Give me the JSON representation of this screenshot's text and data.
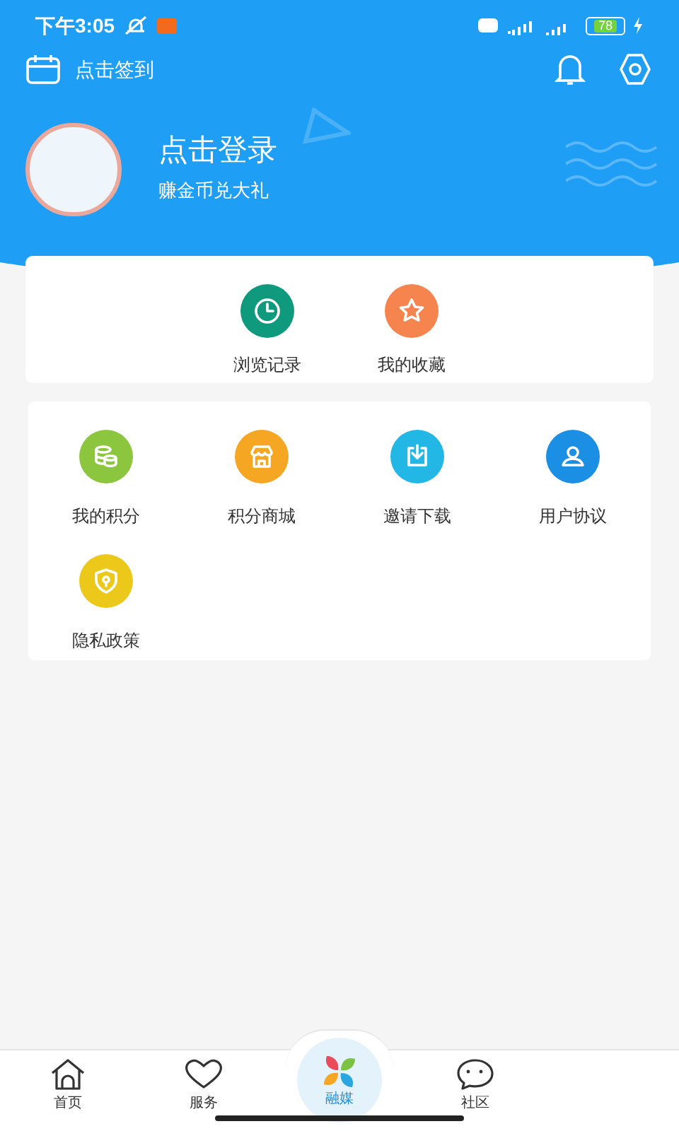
{
  "status_bar": {
    "time": "下午3:05",
    "battery": "78"
  },
  "header": {
    "checkin": "点击签到",
    "login_title": "点击登录",
    "login_subtitle": "赚金币兑大礼"
  },
  "quick_links": [
    {
      "label": "浏览记录",
      "kind": "clock",
      "color": "#0f9a7e"
    },
    {
      "label": "我的收藏",
      "kind": "star",
      "color": "#f5844f"
    }
  ],
  "menu": [
    {
      "label": "我的积分",
      "kind": "coins",
      "color": "#8cc63f"
    },
    {
      "label": "积分商城",
      "kind": "shop",
      "color": "#f5a623"
    },
    {
      "label": "邀请下载",
      "kind": "download",
      "color": "#23b7e5"
    },
    {
      "label": "用户协议",
      "kind": "user",
      "color": "#1a8fe3"
    },
    {
      "label": "隐私政策",
      "kind": "shield",
      "color": "#ecc81a"
    }
  ],
  "tab_bar": [
    {
      "label": "首页",
      "kind": "home"
    },
    {
      "label": "服务",
      "kind": "heart"
    },
    {
      "label": "融媒",
      "kind": "center"
    },
    {
      "label": "社区",
      "kind": "chat"
    }
  ]
}
